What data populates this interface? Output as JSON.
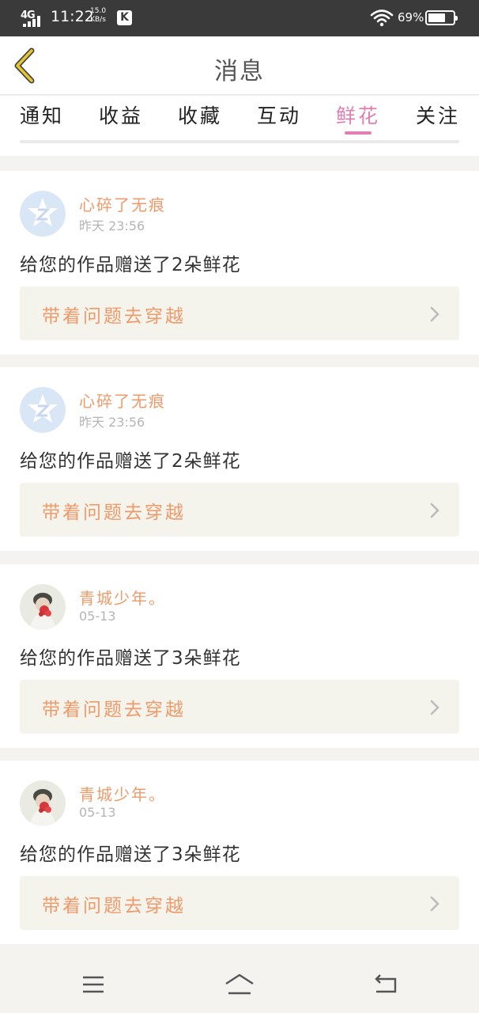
{
  "status_bar": {
    "network": "4G",
    "time": "11:22",
    "speed_value": "15.0",
    "speed_unit": "KB/s",
    "app_badge": "K",
    "battery": "69%",
    "battery_level": 0.69
  },
  "header": {
    "title": "消息"
  },
  "tabs": [
    {
      "label": "通知"
    },
    {
      "label": "收益"
    },
    {
      "label": "收藏"
    },
    {
      "label": "互动"
    },
    {
      "label": "鲜花"
    },
    {
      "label": "关注"
    }
  ],
  "active_tab": "鲜花",
  "messages": [
    {
      "user": "心碎了无痕",
      "time": "昨天 23:56",
      "text": "给您的作品赠送了2朵鲜花",
      "work_title": "带着问题去穿越",
      "avatar": "qq-default-avatar"
    },
    {
      "user": "心碎了无痕",
      "time": "昨天 23:56",
      "text": "给您的作品赠送了2朵鲜花",
      "work_title": "带着问题去穿越",
      "avatar": "qq-default-avatar"
    },
    {
      "user": "青城少年。",
      "time": "05-13",
      "text": "给您的作品赠送了3朵鲜花",
      "work_title": "带着问题去穿越",
      "avatar": "photo-avatar"
    },
    {
      "user": "青城少年。",
      "time": "05-13",
      "text": "给您的作品赠送了3朵鲜花",
      "work_title": "带着问题去穿越",
      "avatar": "photo-avatar"
    }
  ],
  "colors": {
    "accent_pink": "#e07fb0",
    "name_orange": "#ef9a6a",
    "back_arrow_yellow": "#e8c62e"
  },
  "nav_bar": {
    "icons": [
      "menu-icon",
      "home-icon",
      "back-icon"
    ]
  }
}
